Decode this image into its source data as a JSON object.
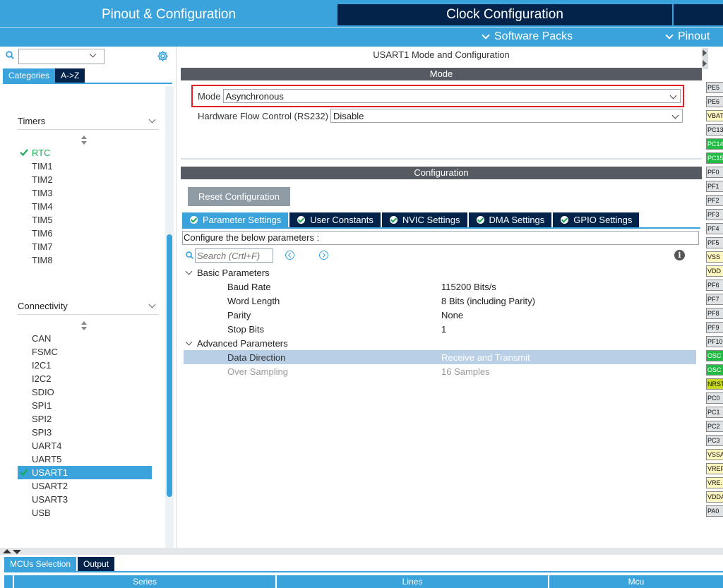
{
  "header": {
    "tabs": [
      "Pinout & Configuration",
      "Clock Configuration",
      ""
    ],
    "software_packs": "Software Packs",
    "pinout": "Pinout"
  },
  "left": {
    "search_value": "",
    "category_tabs": [
      "Categories",
      "A->Z"
    ],
    "timers": {
      "title": "Timers",
      "items": [
        "RTC",
        "TIM1",
        "TIM2",
        "TIM3",
        "TIM4",
        "TIM5",
        "TIM6",
        "TIM7",
        "TIM8"
      ]
    },
    "connectivity": {
      "title": "Connectivity",
      "items": [
        "CAN",
        "FSMC",
        "I2C1",
        "I2C2",
        "SDIO",
        "SPI1",
        "SPI2",
        "SPI3",
        "UART4",
        "UART5",
        "USART1",
        "USART2",
        "USART3",
        "USB"
      ]
    }
  },
  "main": {
    "title": "USART1 Mode and Configuration",
    "mode_section": "Mode",
    "mode_label": "Mode",
    "mode_value": "Asynchronous",
    "flow_label": "Hardware Flow Control (RS232)",
    "flow_value": "Disable",
    "config_section": "Configuration",
    "reset_button": "Reset Configuration",
    "param_tabs": [
      "Parameter Settings",
      "User Constants",
      "NVIC Settings",
      "DMA Settings",
      "GPIO Settings"
    ],
    "configure_label": "Configure the below parameters :",
    "search_placeholder": "Search (Crtl+F)",
    "info": "i",
    "basic_group": "Basic Parameters",
    "basic_params": [
      {
        "name": "Baud Rate",
        "value": "115200 Bits/s"
      },
      {
        "name": "Word Length",
        "value": "8 Bits (including Parity)"
      },
      {
        "name": "Parity",
        "value": "None"
      },
      {
        "name": "Stop Bits",
        "value": "1"
      }
    ],
    "advanced_group": "Advanced Parameters",
    "advanced_params": [
      {
        "name": "Data Direction",
        "value": "Receive and Transmit"
      },
      {
        "name": "Over Sampling",
        "value": "16 Samples"
      }
    ]
  },
  "pins": [
    "PE5",
    "PE6",
    "VBAT",
    "PC13",
    "PC14",
    "PC15",
    "PF0",
    "PF1",
    "PF2",
    "PF3",
    "PF4",
    "PF5",
    "VSS",
    "VDD",
    "PF6",
    "PF7",
    "PF8",
    "PF9",
    "PF10",
    "OSC",
    "OSC",
    "NRST",
    "PC0",
    "PC1",
    "PC2",
    "PC3",
    "VSSA",
    "VREF",
    "VRE.",
    "VDDA",
    "PA0"
  ],
  "bottom": {
    "tabs": [
      "MCUs Selection",
      "Output"
    ],
    "columns": [
      "Series",
      "Lines",
      "Mcu"
    ]
  },
  "colors": {
    "accent": "#3aa3dc",
    "navy": "#03234b",
    "highlight_red": "#e01e24",
    "check_green": "#1aaa55"
  }
}
